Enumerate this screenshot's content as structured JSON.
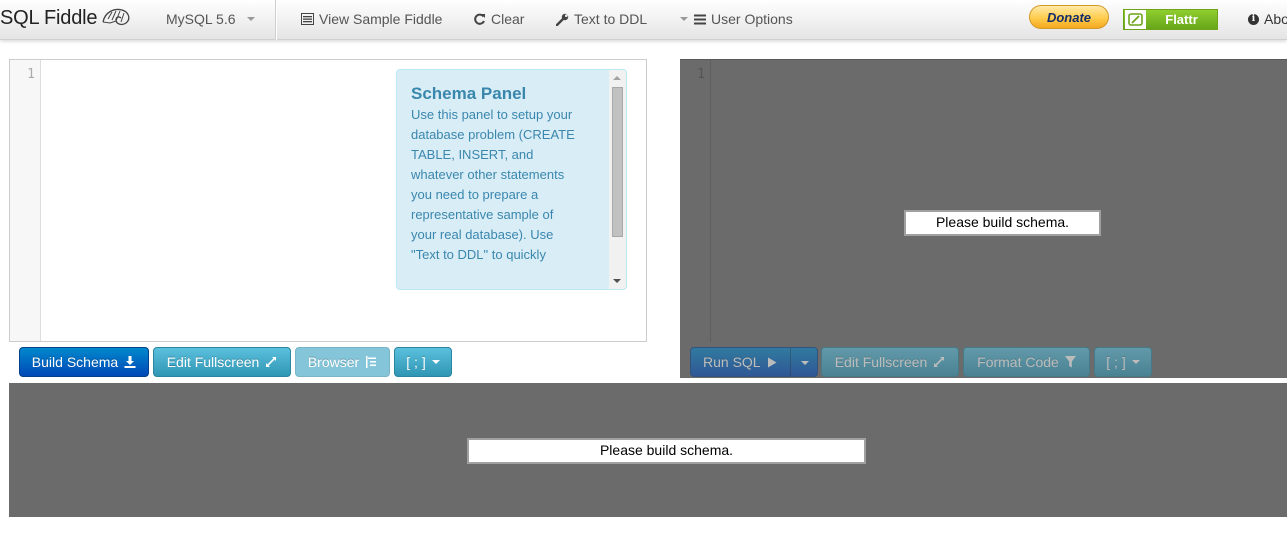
{
  "navbar": {
    "brand": "SQL Fiddle",
    "db_version": "MySQL 5.6",
    "view_sample": "View Sample Fiddle",
    "clear": "Clear",
    "text_to_ddl": "Text to DDL",
    "user_options": "User Options",
    "donate": "Donate",
    "flattr": "Flattr",
    "about": "Abo"
  },
  "schema_panel": {
    "line_number": "1",
    "help_title": "Schema Panel",
    "help_body": "Use this panel to setup your database problem (CREATE TABLE, INSERT, and whatever other statements you need to prepare a representative sample of your real database). Use \"Text to DDL\" to quickly"
  },
  "schema_buttons": {
    "build": "Build Schema",
    "edit_fullscreen": "Edit Fullscreen",
    "browser": "Browser",
    "terminator": "[ ; ]"
  },
  "sql_panel": {
    "line_number": "1",
    "message": "Please build schema."
  },
  "sql_buttons": {
    "run": "Run SQL",
    "edit_fullscreen": "Edit Fullscreen",
    "format_code": "Format Code",
    "terminator": "[ ; ]"
  },
  "results": {
    "message": "Please build schema."
  }
}
